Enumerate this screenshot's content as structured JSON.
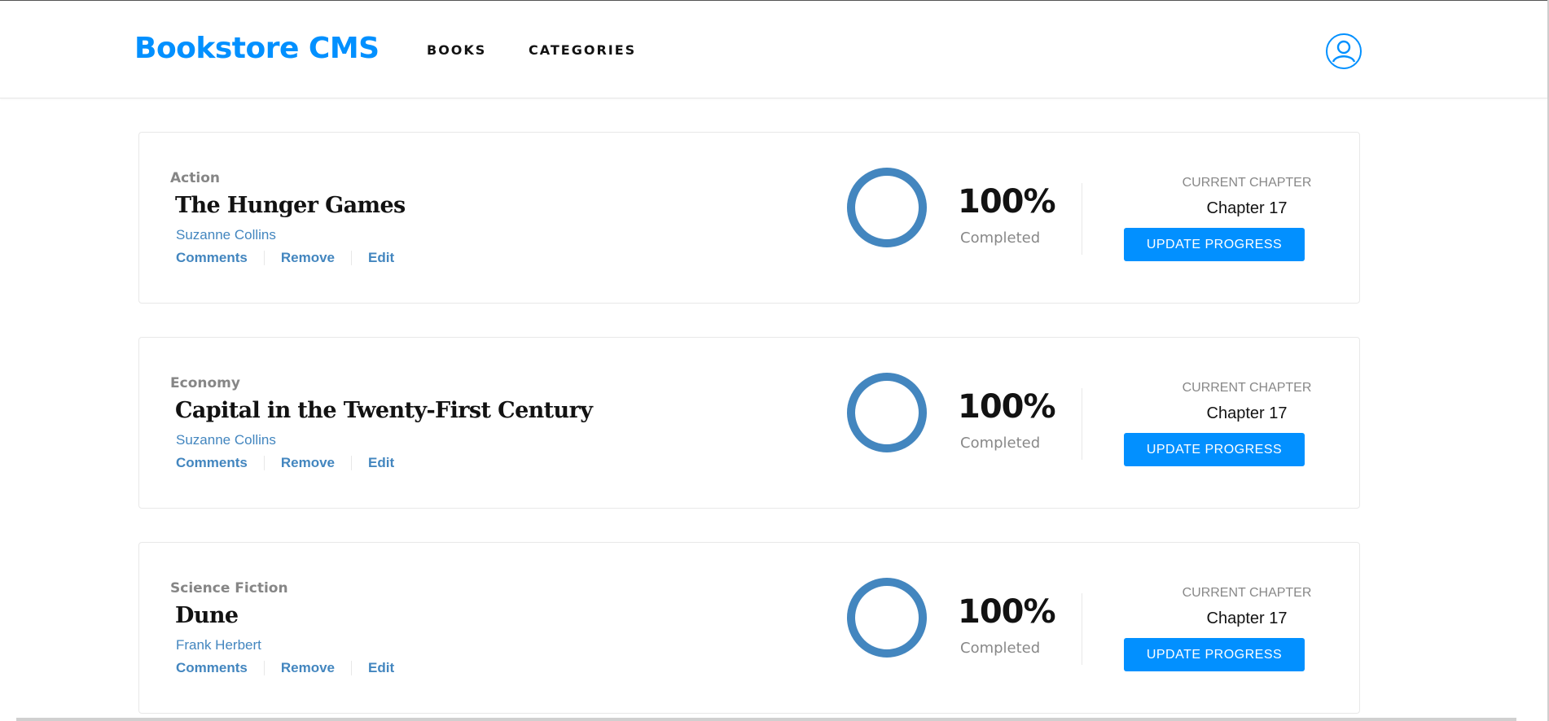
{
  "header": {
    "logo": "Bookstore CMS",
    "nav": [
      "BOOKS",
      "CATEGORIES"
    ],
    "user_icon": "user-circle-icon"
  },
  "books": [
    {
      "genre": "Action",
      "title": "The Hunger Games",
      "author": "Suzanne Collins",
      "actions": [
        "Comments",
        "Remove",
        "Edit"
      ],
      "percent_text": "100%",
      "progress": 1.0,
      "completed_label": "Completed",
      "current_chapter_label": "CURRENT CHAPTER",
      "current_chapter": "Chapter 17",
      "button": "UPDATE PROGRESS"
    },
    {
      "genre": "Economy",
      "title": "Capital in the Twenty-First Century",
      "author": "Suzanne Collins",
      "actions": [
        "Comments",
        "Remove",
        "Edit"
      ],
      "percent_text": "100%",
      "progress": 1.0,
      "completed_label": "Completed",
      "current_chapter_label": "CURRENT CHAPTER",
      "current_chapter": "Chapter 17",
      "button": "UPDATE PROGRESS"
    },
    {
      "genre": "Science Fiction",
      "title": "Dune",
      "author": "Frank Herbert",
      "actions": [
        "Comments",
        "Remove",
        "Edit"
      ],
      "percent_text": "100%",
      "progress": 1.0,
      "completed_label": "Completed",
      "current_chapter_label": "CURRENT CHAPTER",
      "current_chapter": "Chapter 17",
      "button": "UPDATE PROGRESS"
    }
  ],
  "colors": {
    "brand": "#0290ff",
    "link": "#4386bf",
    "progress_ring": "#4386bf",
    "text": "#121212",
    "muted": "#888888"
  }
}
